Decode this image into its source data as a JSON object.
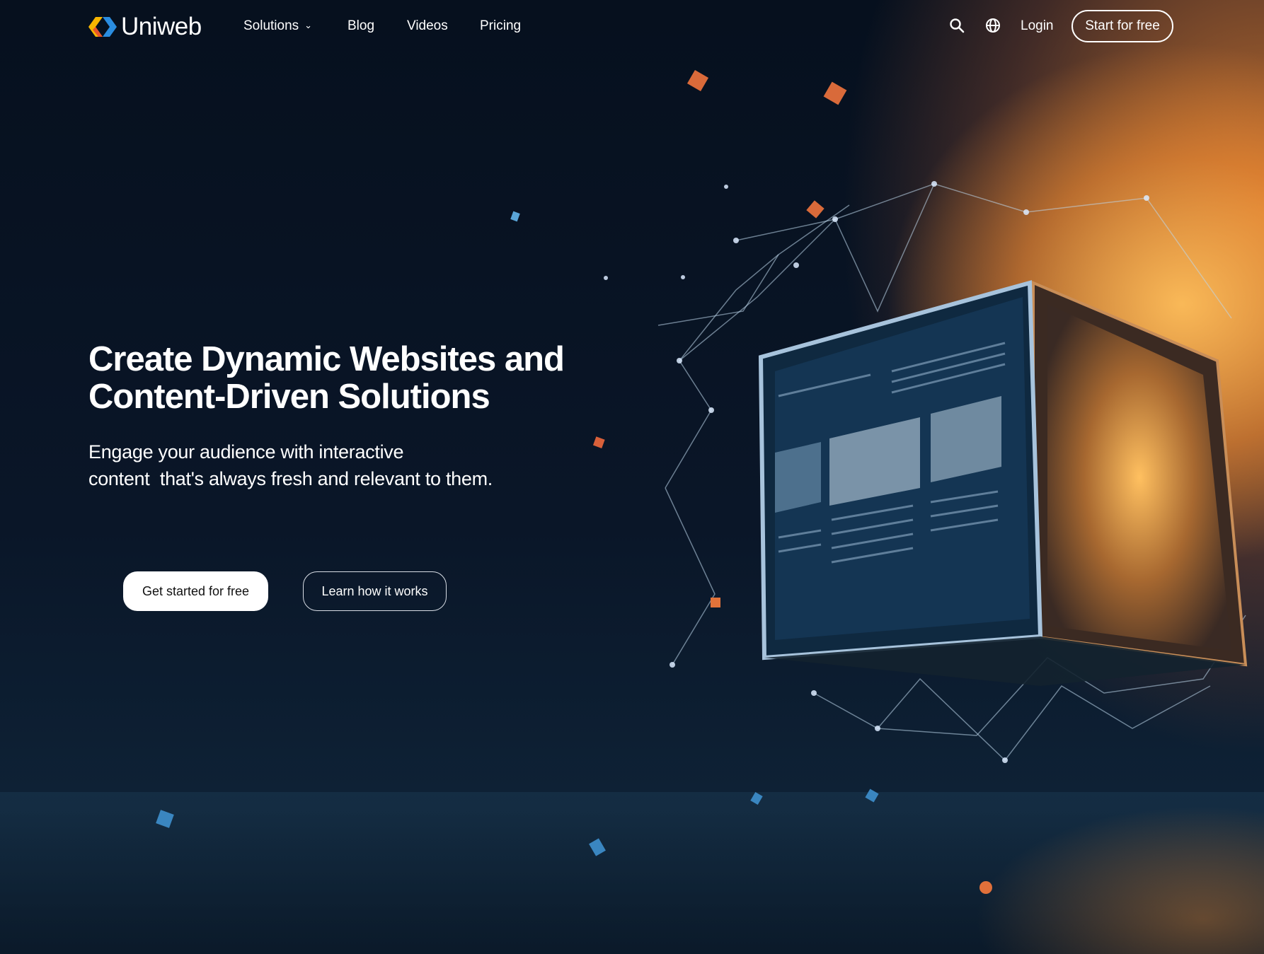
{
  "brand": {
    "name": "Uniweb",
    "logo_colors": [
      "#f7b500",
      "#e8552a",
      "#2a8de0"
    ]
  },
  "nav": {
    "items": [
      {
        "label": "Solutions",
        "has_dropdown": true
      },
      {
        "label": "Blog"
      },
      {
        "label": "Videos"
      },
      {
        "label": "Pricing"
      }
    ],
    "search_icon": "search-icon",
    "language_icon": "globe-icon",
    "login_label": "Login",
    "cta_label": "Start for free"
  },
  "hero": {
    "title_line1": "Create Dynamic Websites and",
    "title_line2": "Content-Driven Solutions",
    "subtitle_line1": "Engage your audience with interactive",
    "subtitle_line2": "content  that's always fresh and relevant to them.",
    "primary_button": "Get started for free",
    "secondary_button": "Learn how it works"
  },
  "colors": {
    "background": "#07101f",
    "accent_glow": "#f5a34a"
  }
}
